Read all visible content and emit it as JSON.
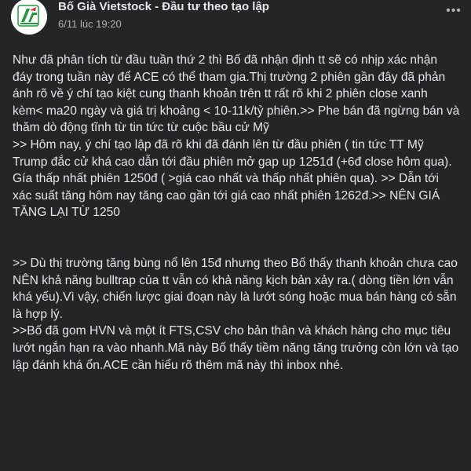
{
  "post": {
    "page_name": "Bố Già Vietstock - Đầu tư theo tạo lập",
    "timestamp": "6/11 lúc 19:20",
    "more_icon": "more-horizontal-icon",
    "paragraphs": [
      "Như đã phân tích từ đầu tuần thứ 2 thì Bố đã nhận định tt sẽ có nhịp xác nhận đáy trong tuần này để ACE có thể tham gia.Thị trường 2 phiên gần đây đã phản ánh rõ về ý chí tạo kiệt cung thanh khoản trên tt rất rõ khi 2 phiên close xanh kèm< ma20 ngày và giá trị khoảng < 10-11k/tỷ phiên.>> Phe bán đã ngừng bán và thăm dò động tĩnh từ tin tức từ cuộc bầu cử Mỹ",
      ">> Hôm nay, ý chí tạo lập đã rõ khi đã đánh lên từ đầu phiên ( tin tức TT Mỹ Trump đắc cử khá cao dẫn tới đầu phiên mở gap up 1251đ (+6đ close hôm qua). Gía thấp nhất phiên 1250đ ( >giá cao nhất và thấp nhất phiên qua). >> Dẫn tới xác suất tăng hôm nay tăng cao gần tới giá cao nhất phiên 1262đ.>> NÊN GIÁ TĂNG LẠI TỪ 1250",
      ">> Dù thị trường tăng bùng nổ lên 15đ nhưng theo Bố thấy thanh khoản chưa cao NÊN khả năng bulltrap của tt vẫn có khả năng kịch bản xảy ra.( dòng tiền lớn vẫn khá yếu).Vì vậy, chiến lược giai đoạn này là lướt sóng hoặc mua bán hàng có sẵn là hợp lý.",
      ">>Bố đã gom HVN và một ít FTS,CSV cho bản thân và khách hàng cho mục tiêu lướt ngắn hạn ra vào nhanh.Mã này Bố thấy tiềm năng tăng trưởng còn lớn và tạo lập đánh khá ổn.ACE cần hiểu rõ thêm mã này thì inbox nhé."
    ]
  },
  "colors": {
    "background": "#242526",
    "text_primary": "#e4e6eb",
    "text_secondary": "#b0b3b8",
    "avatar_green": "#1f9a3a",
    "avatar_red": "#d62828"
  }
}
